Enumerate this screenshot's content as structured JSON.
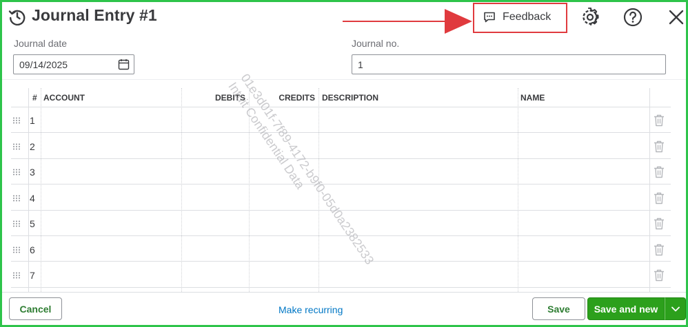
{
  "header": {
    "title": "Journal Entry #1",
    "feedback_label": "Feedback",
    "history_icon": "history-icon",
    "settings_icon": "gear-icon",
    "help_icon": "help-icon",
    "close_icon": "close-icon"
  },
  "fields": {
    "journal_date_label": "Journal date",
    "journal_date_value": "09/14/2025",
    "journal_no_label": "Journal no.",
    "journal_no_value": "1"
  },
  "table": {
    "columns": [
      "#",
      "ACCOUNT",
      "DEBITS",
      "CREDITS",
      "DESCRIPTION",
      "NAME"
    ],
    "rows": [
      "1",
      "2",
      "3",
      "4",
      "5",
      "6",
      "7"
    ]
  },
  "watermark": {
    "line1": "01e3d01f-7f89-4172-b9f0-05d0a2382533",
    "line2": "Intuit Confidential Data"
  },
  "footer": {
    "cancel_label": "Cancel",
    "make_recurring_label": "Make recurring",
    "save_label": "Save",
    "save_and_new_label": "Save and new"
  },
  "colors": {
    "frame_border": "#2ec44a",
    "annotation_red": "#e03a3e",
    "primary_green": "#2ca01c",
    "link_blue": "#0077c5"
  }
}
